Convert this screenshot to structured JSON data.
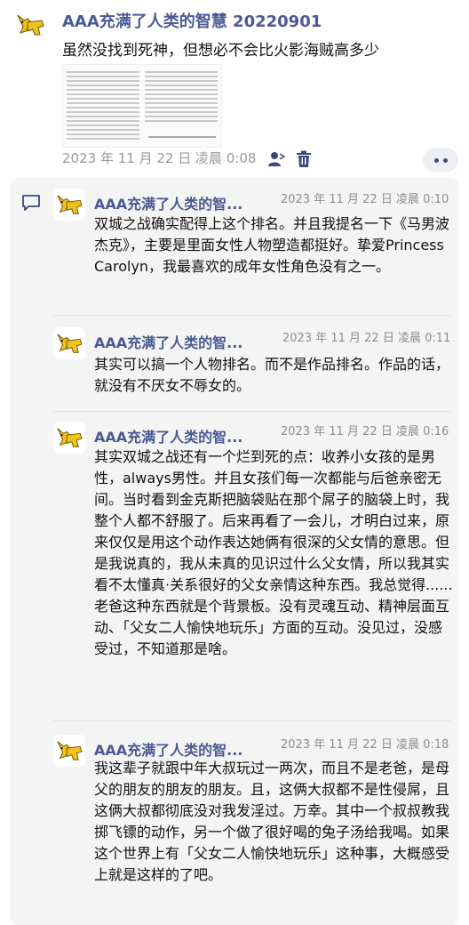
{
  "post": {
    "author": "AAA充满了人类的智慧 20220901",
    "text": "虽然没找到死神，但想必不会比火影海贼高多少",
    "timestamp": "2023 年 11 月 22 日  凌晨 0:08"
  },
  "comments": [
    {
      "author": "AAA充满了人类的智...",
      "time": "2023 年 11 月 22 日 凌晨 0:10",
      "text": "双城之战确实配得上这个排名。并且我提名一下《马男波杰克》，主要是里面女性人物塑造都挺好。挚爱Princess Carolyn，我最喜欢的成年女性角色没有之一。"
    },
    {
      "author": "AAA充满了人类的智...",
      "time": "2023 年 11 月 22 日 凌晨 0:11",
      "text": "其实可以搞一个人物排名。而不是作品排名。作品的话，就没有不厌女不辱女的。"
    },
    {
      "author": "AAA充满了人类的智...",
      "time": "2023 年 11 月 22 日 凌晨 0:16",
      "text": "其实双城之战还有一个烂到死的点：收养小女孩的是男性，always男性。并且女孩们每一次都能与后爸亲密无间。当时看到金克斯把脑袋贴在那个屌子的脑袋上时，我整个人都不舒服了。后来再看了一会儿，才明白过来，原来仅仅是用这个动作表达她俩有很深的父女情的意思。但是我说真的，我从未真的见识过什么父女情，所以我其实看不太懂真·关系很好的父女亲情这种东西。我总觉得......老爸这种东西就是个背景板。没有灵魂互动、精神层面互动、「父女二人愉快地玩乐」方面的互动。没见过，没感受过，不知道那是啥。"
    },
    {
      "author": "AAA充满了人类的智...",
      "time": "2023 年 11 月 22 日 凌晨 0:18",
      "text": "我这辈子就跟中年大叔玩过一两次，而且不是老爸，是母父的朋友的朋友的朋友。且，这俩大叔都不是性侵屌，且这俩大叔都彻底没对我发淫过。万幸。其中一个叔叔教我掷飞镖的动作，另一个做了很好喝的兔子汤给我喝。如果这个世界上有「父女二人愉快地玩乐」这种事，大概感受上就是这样的了吧。"
    }
  ],
  "colors": {
    "name": "#4a5a93",
    "meta": "#9a9a9a",
    "panel": "#f4f4f4",
    "avatar_fox": "#f2c21b"
  },
  "icons": {
    "avatar": "yellow-fox-avatar-icon",
    "user": "user-icon",
    "delete": "trash-icon",
    "more": "more-dots-icon",
    "comment": "comment-icon"
  }
}
